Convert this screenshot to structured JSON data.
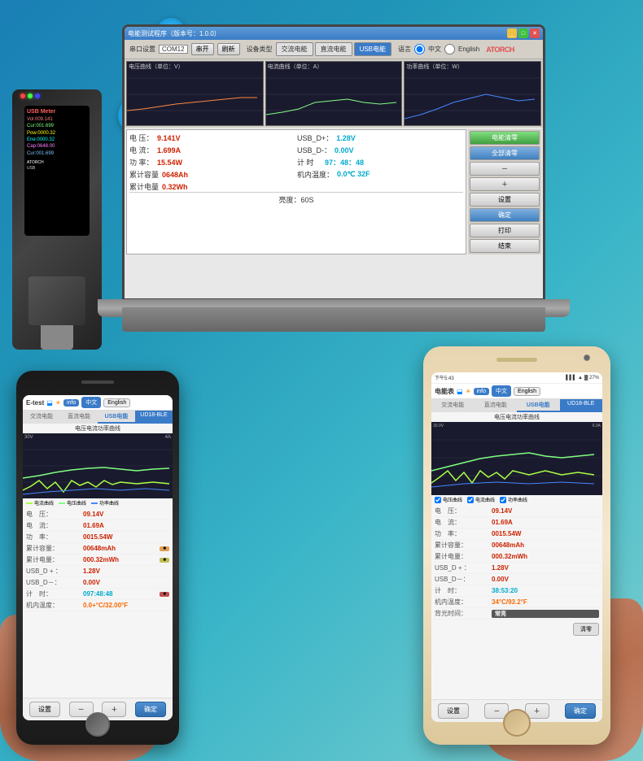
{
  "app": {
    "title": "电能测试程序（版本号：1.0.0）",
    "software": {
      "titlebar": "电能测试程序（版本号：1.0.0）",
      "toolbar": {
        "port_label": "串口设置",
        "port_value": "COM12",
        "open_btn": "串开",
        "refresh_btn": "刷新",
        "device_type_label": "设备类型",
        "device_ac": "交流电能",
        "device_dc": "直流电能",
        "device_usb": "USB电能",
        "lang_label": "语言",
        "lang_cn": "中文",
        "lang_en": "English",
        "logo": "ATORCH"
      },
      "data": {
        "voltage": "9.141V",
        "voltage_label": "电压",
        "current": "1.699A",
        "current_label": "电流",
        "power": "15.54W",
        "power_label": "功率",
        "capacity": "0648Ah",
        "capacity_label": "累计容量",
        "energy": "0.32Wh",
        "energy_label": "累计电量",
        "usb_d_plus": "1.28V",
        "usb_d_plus_label": "USB_D+：",
        "usb_d_minus": "0.00V",
        "usb_d_minus_label": "USB_D-：",
        "timer": "97：48：48",
        "timer_label": "计时",
        "temp": "0.0℃ 32F",
        "temp_label": "机内温度：",
        "brightness": "亮度：60S"
      }
    },
    "phone_left": {
      "app_name": "E-test",
      "info_badge": "info",
      "lang_cn": "中文",
      "lang_en": "English",
      "tabs": {
        "ac": "交流电能",
        "dc": "直流电能",
        "usb": "USB电能",
        "ble": "UD18-BLE"
      },
      "chart_title": "电压电流功率曲线",
      "chart_yaxis_left": "30V",
      "chart_yaxis_right": "4A",
      "legend": {
        "current": "电流曲线",
        "voltage": "电压曲线",
        "power": "功率曲线"
      },
      "data": {
        "voltage_label": "电　压：",
        "voltage_value": "09.14V",
        "current_label": "电　流：",
        "current_value": "01.69A",
        "power_label": "功　率：",
        "power_value": "0015.54W",
        "capacity_label": "累计容量：",
        "capacity_value": "00648mAh",
        "energy_label": "累计电量：",
        "energy_value": "000.32mWh",
        "usb_plus_label": "USB_D + ：",
        "usb_plus_value": "1.28V",
        "usb_minus_label": "USB_D－：",
        "usb_minus_value": "0.00V",
        "timer_label": "计　时：",
        "timer_value": "097:48:48",
        "temp_label": "机内温度：",
        "temp_value": "0.0+°C/32.00°F"
      },
      "bottom": {
        "settings": "设置",
        "minus": "－",
        "plus": "＋",
        "confirm": "确定"
      }
    },
    "phone_right": {
      "statusbar": "下午5:43",
      "app_name": "电能表",
      "info_badge": "info",
      "lang_cn": "中文",
      "lang_en": "English",
      "tabs": {
        "ac": "交流电能",
        "dc": "直流电能",
        "usb": "USB电能",
        "ble": "UD18-BLE"
      },
      "chart_title": "电压电流功率曲线",
      "legend": {
        "voltage": "电压曲线",
        "current": "电流曲线",
        "power": "功率曲线"
      },
      "data": {
        "voltage_label": "电　压：",
        "voltage_value": "09.14V",
        "current_label": "电　流：",
        "current_value": "01.69A",
        "power_label": "功　率：",
        "power_value": "0015.54W",
        "capacity_label": "累计容量：",
        "capacity_value": "00648mAh",
        "energy_label": "累计电量：",
        "energy_value": "000.32mWh",
        "usb_plus_label": "USB_D + ：",
        "usb_plus_value": "1.28V",
        "usb_minus_label": "USB_D－：",
        "usb_minus_value": "0.00V",
        "timer_label": "计　时：",
        "timer_value": "38:53:20",
        "temp_label": "机内温度：",
        "temp_value": "34°C/93.2°F",
        "backlight_label": "背光时间：",
        "backlight_value": "常亮"
      },
      "bottom": {
        "settings": "设置",
        "minus": "－",
        "plus": "＋",
        "confirm": "确定"
      }
    }
  }
}
